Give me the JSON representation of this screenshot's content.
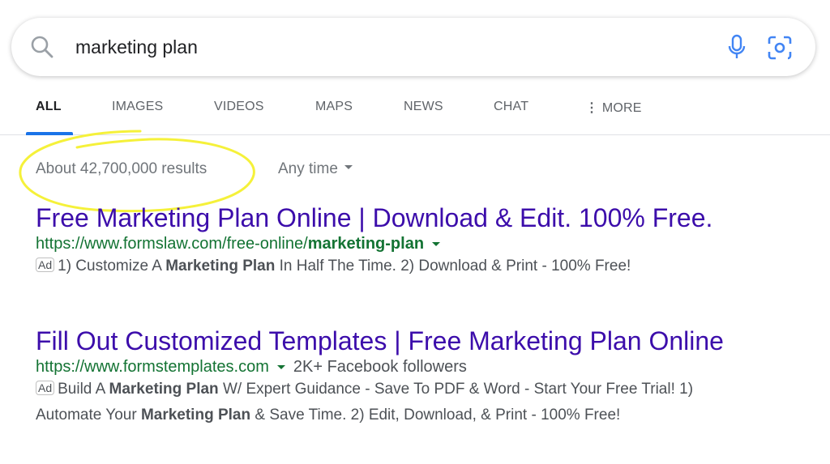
{
  "search": {
    "query": "marketing plan"
  },
  "tabs": [
    {
      "label": "ALL",
      "active": true
    },
    {
      "label": "IMAGES"
    },
    {
      "label": "VIDEOS"
    },
    {
      "label": "MAPS"
    },
    {
      "label": "NEWS"
    },
    {
      "label": "CHAT"
    },
    {
      "label": "MORE",
      "icon": "vertical-dots-icon"
    }
  ],
  "result_stats": "About 42,700,000 results",
  "time_filter": "Any time",
  "results": [
    {
      "title": "Free Marketing Plan Online | Download & Edit. 100% Free.",
      "url_prefix": "https://www.formslaw.com/free-online/",
      "url_bold": "marketing-plan",
      "ad_label": "Ad",
      "desc_1": "1) Customize A ",
      "desc_bold_1": "Marketing Plan",
      "desc_2": " In Half The Time. 2) Download & Print - 100% Free!"
    },
    {
      "title": "Fill Out Customized Templates | Free Marketing Plan Online",
      "url_prefix": "https://www.formstemplates.com",
      "followers": "2K+ Facebook followers",
      "ad_label": "Ad",
      "line1_a": "Build A ",
      "line1_bold": "Marketing Plan",
      "line1_b": " W/ Expert Guidance - Save To PDF & Word - Start Your Free Trial! 1)",
      "line2_a": "Automate Your ",
      "line2_bold": "Marketing Plan",
      "line2_b": " & Save Time. 2) Edit, Download, & Print - 100% Free!"
    }
  ],
  "colors": {
    "link": "#3c0dab",
    "url": "#137333",
    "annotation": "#f5f13a",
    "accent": "#1a73e8"
  }
}
